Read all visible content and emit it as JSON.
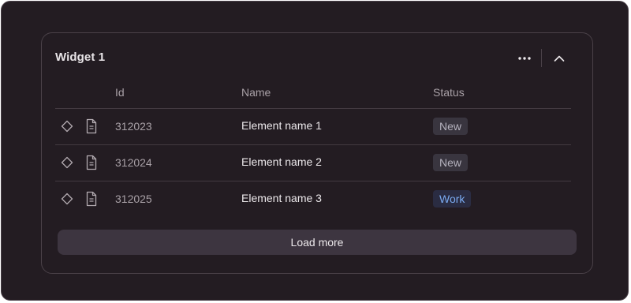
{
  "widget": {
    "title": "Widget 1",
    "columns": {
      "id": "Id",
      "name": "Name",
      "status": "Status"
    },
    "rows": [
      {
        "id": "312023",
        "name": "Element name 1",
        "status": "New",
        "status_kind": "new"
      },
      {
        "id": "312024",
        "name": "Element name 2",
        "status": "New",
        "status_kind": "new"
      },
      {
        "id": "312025",
        "name": "Element name 3",
        "status": "Work",
        "status_kind": "work"
      }
    ],
    "load_more_label": "Load more"
  },
  "icons": {
    "menu": "more-horizontal-icon",
    "collapse": "chevron-up-icon",
    "row_action": "diamond-icon",
    "row_type": "document-icon"
  },
  "colors": {
    "background": "#231c22",
    "status_new_bg": "#39353f",
    "status_new_text": "#b4b1bd",
    "status_work_bg": "#2a2c42",
    "status_work_text": "#7aaaf0"
  }
}
